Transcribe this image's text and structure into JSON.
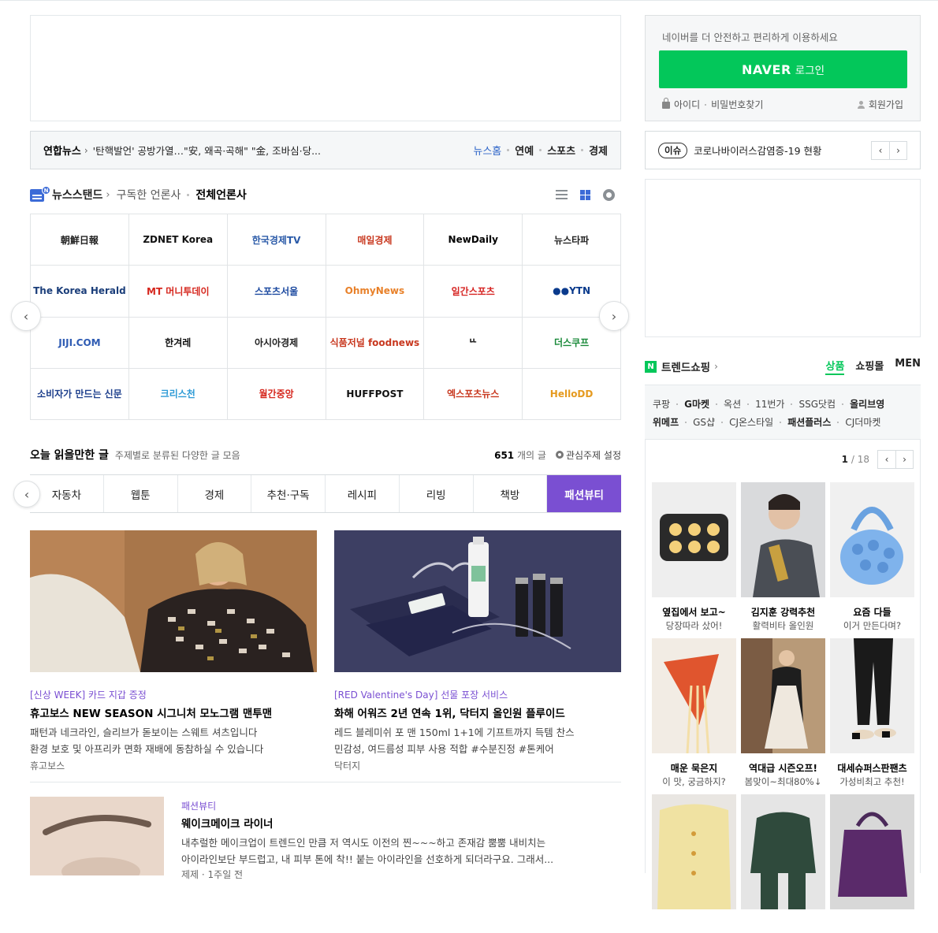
{
  "newsbar": {
    "source": "연합뉴스",
    "headline": "'탄핵발언' 공방가열…\"安, 왜곡·곡해\" \"金, 조바심·당...",
    "tabs": [
      "뉴스홈",
      "연예",
      "스포츠",
      "경제"
    ]
  },
  "newsstand": {
    "title": "뉴스스탠드",
    "subscribed": "구독한 언론사",
    "all": "전체언론사",
    "press": [
      "朝鮮日報",
      "ZDNET Korea",
      "한국경제TV",
      "매일경제",
      "NewDaily",
      "뉴스타파",
      "The Korea Herald",
      "MT 머니투데이",
      "스포츠서울",
      "OhmyNews",
      "일간스포츠",
      "●●YTN",
      "JIJI.COM",
      "한겨레",
      "아시아경제",
      "식품저널 foodnews",
      "ᄔ",
      "더스쿠프",
      "소비자가 만드는 신문",
      "크리스천",
      "월간중앙",
      "HUFFPOST",
      "엑스포츠뉴스",
      "HelloDD"
    ],
    "press_colors": [
      "#222",
      "#111",
      "#2a5aa8",
      "#c8381f",
      "#000",
      "#222",
      "#1b3e7a",
      "#d6271e",
      "#1d4aa0",
      "#e8812a",
      "#d62422",
      "#0a3a8c",
      "#2e5bb3",
      "#111",
      "#222",
      "#c8381f",
      "#000",
      "#1a8a3a",
      "#1d3f8c",
      "#2e9bd6",
      "#d6271e",
      "#111",
      "#c8381f",
      "#e59a1f"
    ]
  },
  "today": {
    "title": "오늘 읽을만한 글",
    "desc": "주제별로 분류된 다양한 글 모음",
    "count": "651",
    "count_unit": "개의 글",
    "settings": "관심주제 설정",
    "tabs": [
      "자동차",
      "웹툰",
      "경제",
      "추천·구독",
      "레시피",
      "리빙",
      "책방",
      "패션뷰티"
    ],
    "active_tab": "패션뷰티"
  },
  "cards": [
    {
      "cat": "[신상 WEEK] 카드 지갑 증정",
      "title": "휴고보스 NEW SEASON 시그니처 모노그램 맨투맨",
      "body1": "패턴과 네크라인, 슬리브가 돋보이는 스웨트 셔츠입니다",
      "body2": "환경 보호 및 아프리카 면화 재배에 동참하실 수 있습니다",
      "pub": "휴고보스"
    },
    {
      "cat": "[RED Valentine's Day] 선물 포장 서비스",
      "title": "화해 어워즈 2년 연속 1위, 닥터지 올인원 플루이드",
      "body1": "레드 블레미쉬 포 맨 150ml 1+1에 기프트까지 득템 찬스",
      "body2": "민감성, 여드름성 피부 사용 적합 #수분진정 #톤케어",
      "pub": "닥터지"
    }
  ],
  "item2": {
    "cat": "패션뷰티",
    "title": "웨이크메이크 라이너",
    "body1": "내추럴한 메이크업이 트렌드인 만큼 저 역시도 이전의 찐~~~하고 존재감 뿜뿜 내비치는",
    "body2": "아이라인보단 부드럽고, 내 피부 톤에 착!! 붙는 아이라인을 선호하게 되더라구요. 그래서...",
    "pub": "제제 · 1주일 전"
  },
  "login": {
    "message": "네이버를 더 안전하고 편리하게 이용하세요",
    "brand": "NAVER",
    "button": "로그인",
    "id": "아이디",
    "pw": "비밀번호찾기",
    "join": "회원가입"
  },
  "issue": {
    "tag": "이슈",
    "text": "코로나바이러스감염증-19 현황"
  },
  "shopping": {
    "title": "트렌드쇼핑",
    "tabs": [
      "상품",
      "쇼핑몰",
      "MEN"
    ],
    "row1": [
      "쿠팡",
      "G마켓",
      "옥션",
      "11번가",
      "SSG닷컴",
      "올리브영"
    ],
    "row2": [
      "위메프",
      "GS샵",
      "CJ온스타일",
      "패션플러스",
      "CJ더마켓"
    ],
    "page": "1",
    "total": "/ 18",
    "products": [
      {
        "name": "옆집에서 보고~",
        "sub": "당장따라 샀어!"
      },
      {
        "name": "김지훈 강력추천",
        "sub": "활력비타 올인원"
      },
      {
        "name": "요즘 다들",
        "sub": "이거 만든다며?"
      },
      {
        "name": "매운 묵은지",
        "sub": "이 맛, 궁금하지?"
      },
      {
        "name": "역대급 시즌오프!",
        "sub": "봄맞이~최대80%↓"
      },
      {
        "name": "대세슈퍼스판팬츠",
        "sub": "가성비최고 추천!"
      },
      {
        "name": "",
        "sub": ""
      },
      {
        "name": "",
        "sub": ""
      },
      {
        "name": "",
        "sub": ""
      }
    ]
  }
}
